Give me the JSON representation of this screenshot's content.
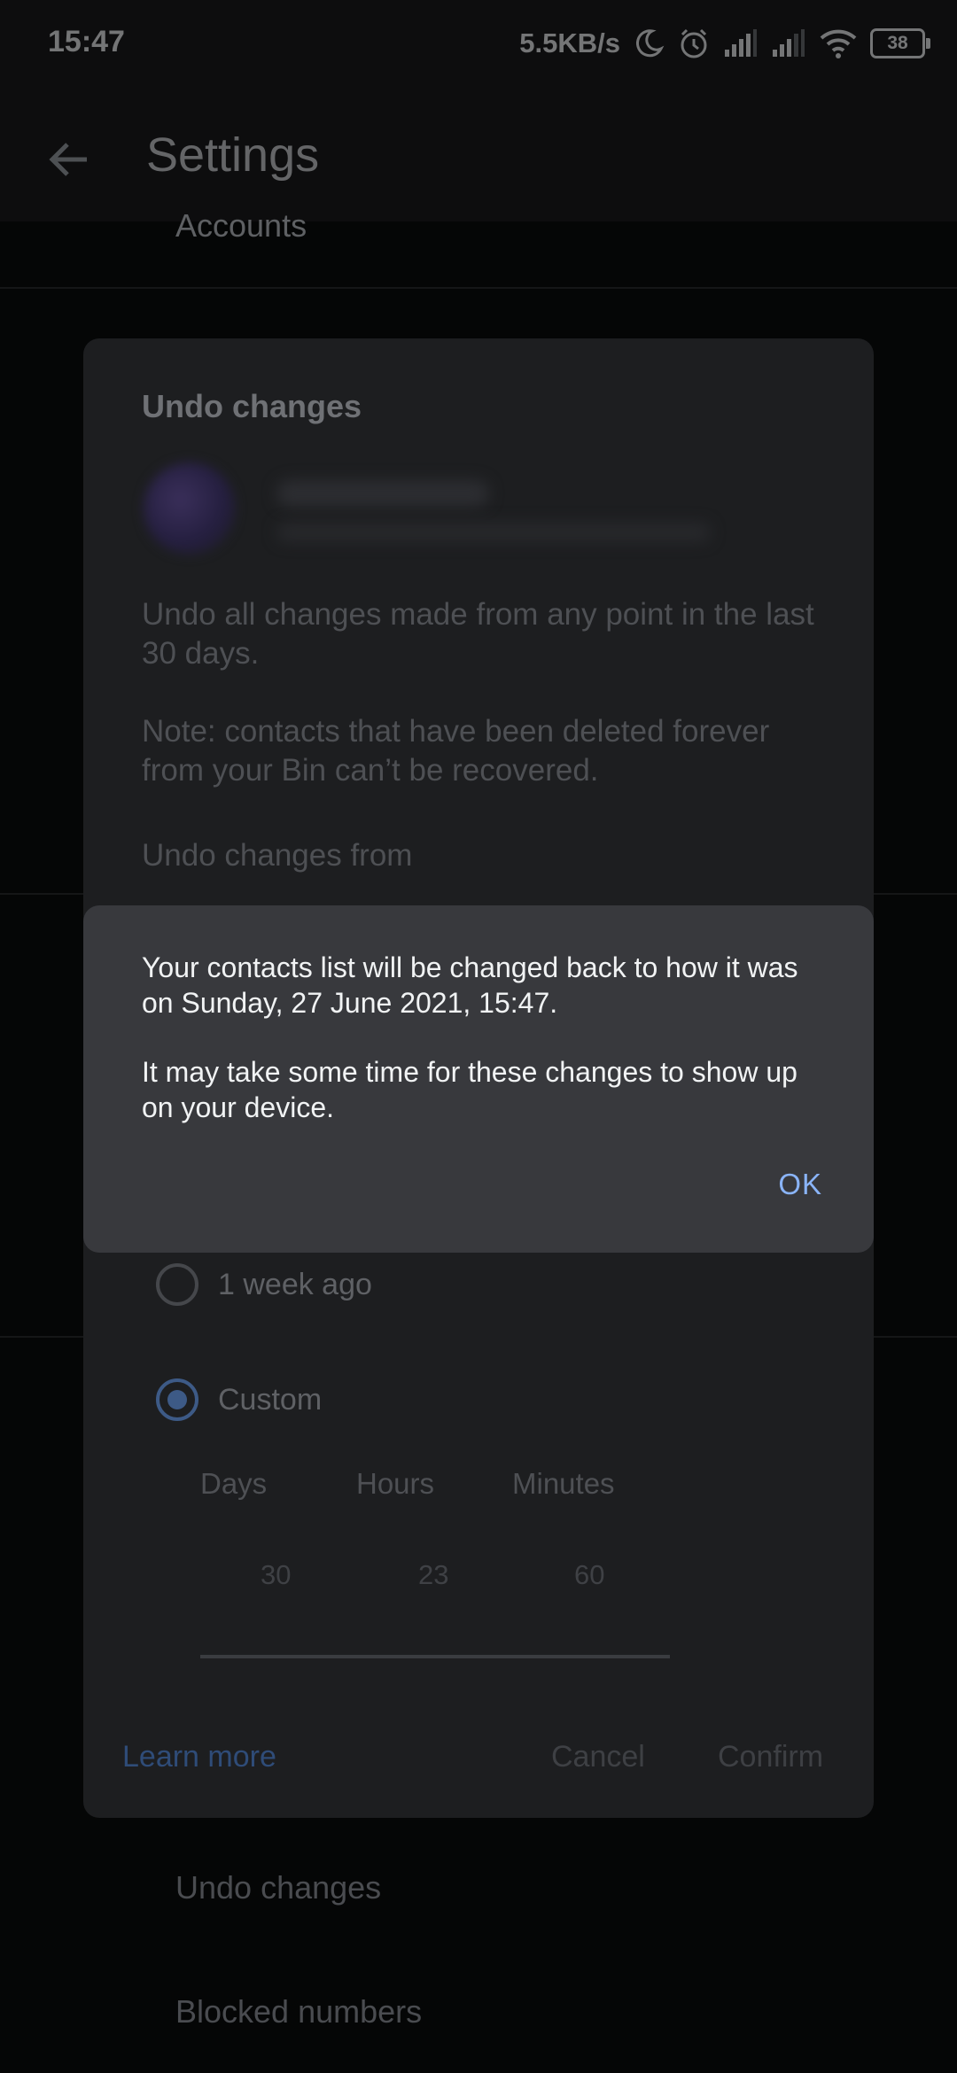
{
  "status_bar": {
    "time": "15:47",
    "net_speed": "5.5KB/s",
    "battery": "38",
    "icons": [
      "moon-icon",
      "alarm-icon",
      "signal-icon",
      "signal-icon",
      "wifi-icon",
      "battery-icon"
    ]
  },
  "app_bar": {
    "title": "Settings",
    "back_icon": "arrow-left-icon"
  },
  "background_list": {
    "accounts_label": "Accounts",
    "undo_changes_label": "Undo changes",
    "blocked_numbers_label": "Blocked numbers"
  },
  "undo_panel": {
    "title": "Undo changes",
    "description": "Undo all changes made from any point in the last 30 days.",
    "note": "Note: contacts that have been deleted forever from your Bin can’t be recovered.",
    "section_label": "Undo changes from",
    "options": [
      {
        "label": "1 week ago",
        "checked": false
      },
      {
        "label": "Custom",
        "checked": true
      }
    ],
    "picker": {
      "columns": [
        "Days",
        "Hours",
        "Minutes"
      ],
      "values": [
        "30",
        "23",
        "60"
      ]
    },
    "learn_more": "Learn more",
    "cancel": "Cancel",
    "confirm": "Confirm"
  },
  "dialog": {
    "message": "Your contacts list will be changed back to how it was on Sunday, 27 June 2021, 15:47.",
    "message2": "It may take some time for these changes to show up on your device.",
    "ok": "OK"
  },
  "colors": {
    "dialog_bg": "#38393d",
    "accent": "#8ab4f8",
    "page_bg": "#0b0c0d"
  }
}
